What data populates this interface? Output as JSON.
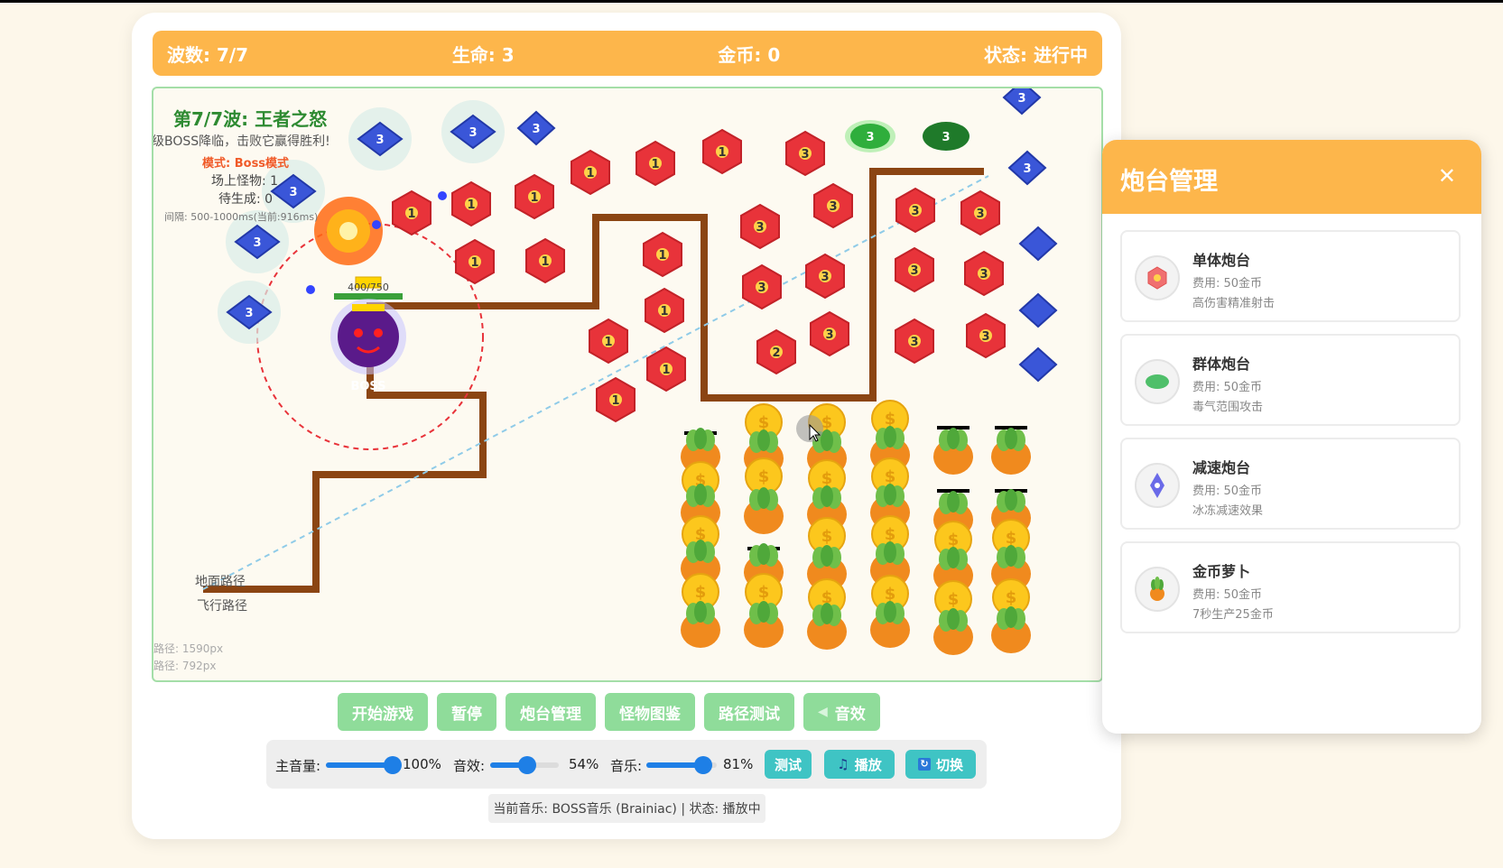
{
  "status": {
    "wave": "波数: 7/7",
    "life": "生命: 3",
    "gold": "金币: 0",
    "state": "状态: 进行中"
  },
  "wave_info": {
    "title": "第7/7波: 王者之怒",
    "subtitle": "级BOSS降临，击败它赢得胜利!",
    "mode": "模式: Boss模式",
    "on_field": "场上怪物: 1",
    "pending": "待生成: 0",
    "interval": "间隔: 500-1000ms(当前:916ms)"
  },
  "boss": {
    "hp_label": "400/750",
    "label": "BOSS"
  },
  "legend": {
    "ground": "地面路径",
    "air": "飞行路径"
  },
  "path_lengths": {
    "ground": "路径: 1590px",
    "air": "路径: 792px"
  },
  "buttons": {
    "start": "开始游戏",
    "pause": "暂停",
    "towers": "炮台管理",
    "monsters": "怪物图鉴",
    "path_test": "路径测试",
    "sound": "音效"
  },
  "audio": {
    "master_label": "主音量:",
    "master_value": 100,
    "master_text": "100%",
    "sfx_label": "音效:",
    "sfx_value": 54,
    "sfx_text": "54%",
    "music_label": "音乐:",
    "music_value": 81,
    "music_text": "81%",
    "test_btn": "测试",
    "play_btn": "播放",
    "switch_btn": "切换"
  },
  "music_status": "当前音乐: BOSS音乐 (Brainiac) | 状态: 播放中",
  "panel": {
    "title": "炮台管理",
    "close": "✕",
    "towers": [
      {
        "name": "单体炮台",
        "cost": "费用: 50金币",
        "desc": "高伤害精准射击",
        "icon": "red-hexagon-icon"
      },
      {
        "name": "群体炮台",
        "cost": "费用: 50金币",
        "desc": "毒气范围攻击",
        "icon": "green-blob-icon"
      },
      {
        "name": "减速炮台",
        "cost": "费用: 50金币",
        "desc": "冰冻减速效果",
        "icon": "blue-diamond-icon"
      },
      {
        "name": "金币萝卜",
        "cost": "费用: 50金币",
        "desc": "7秒生产25金币",
        "icon": "carrot-icon"
      }
    ]
  },
  "colors": {
    "accent": "#fdb64b",
    "button": "#8fdc9a",
    "audio_button": "#3fc4c4",
    "path": "#8b4513",
    "single_tower": "#e8333a",
    "group_tower": "#2fae3c",
    "slow_tower": "#3a56d8"
  }
}
